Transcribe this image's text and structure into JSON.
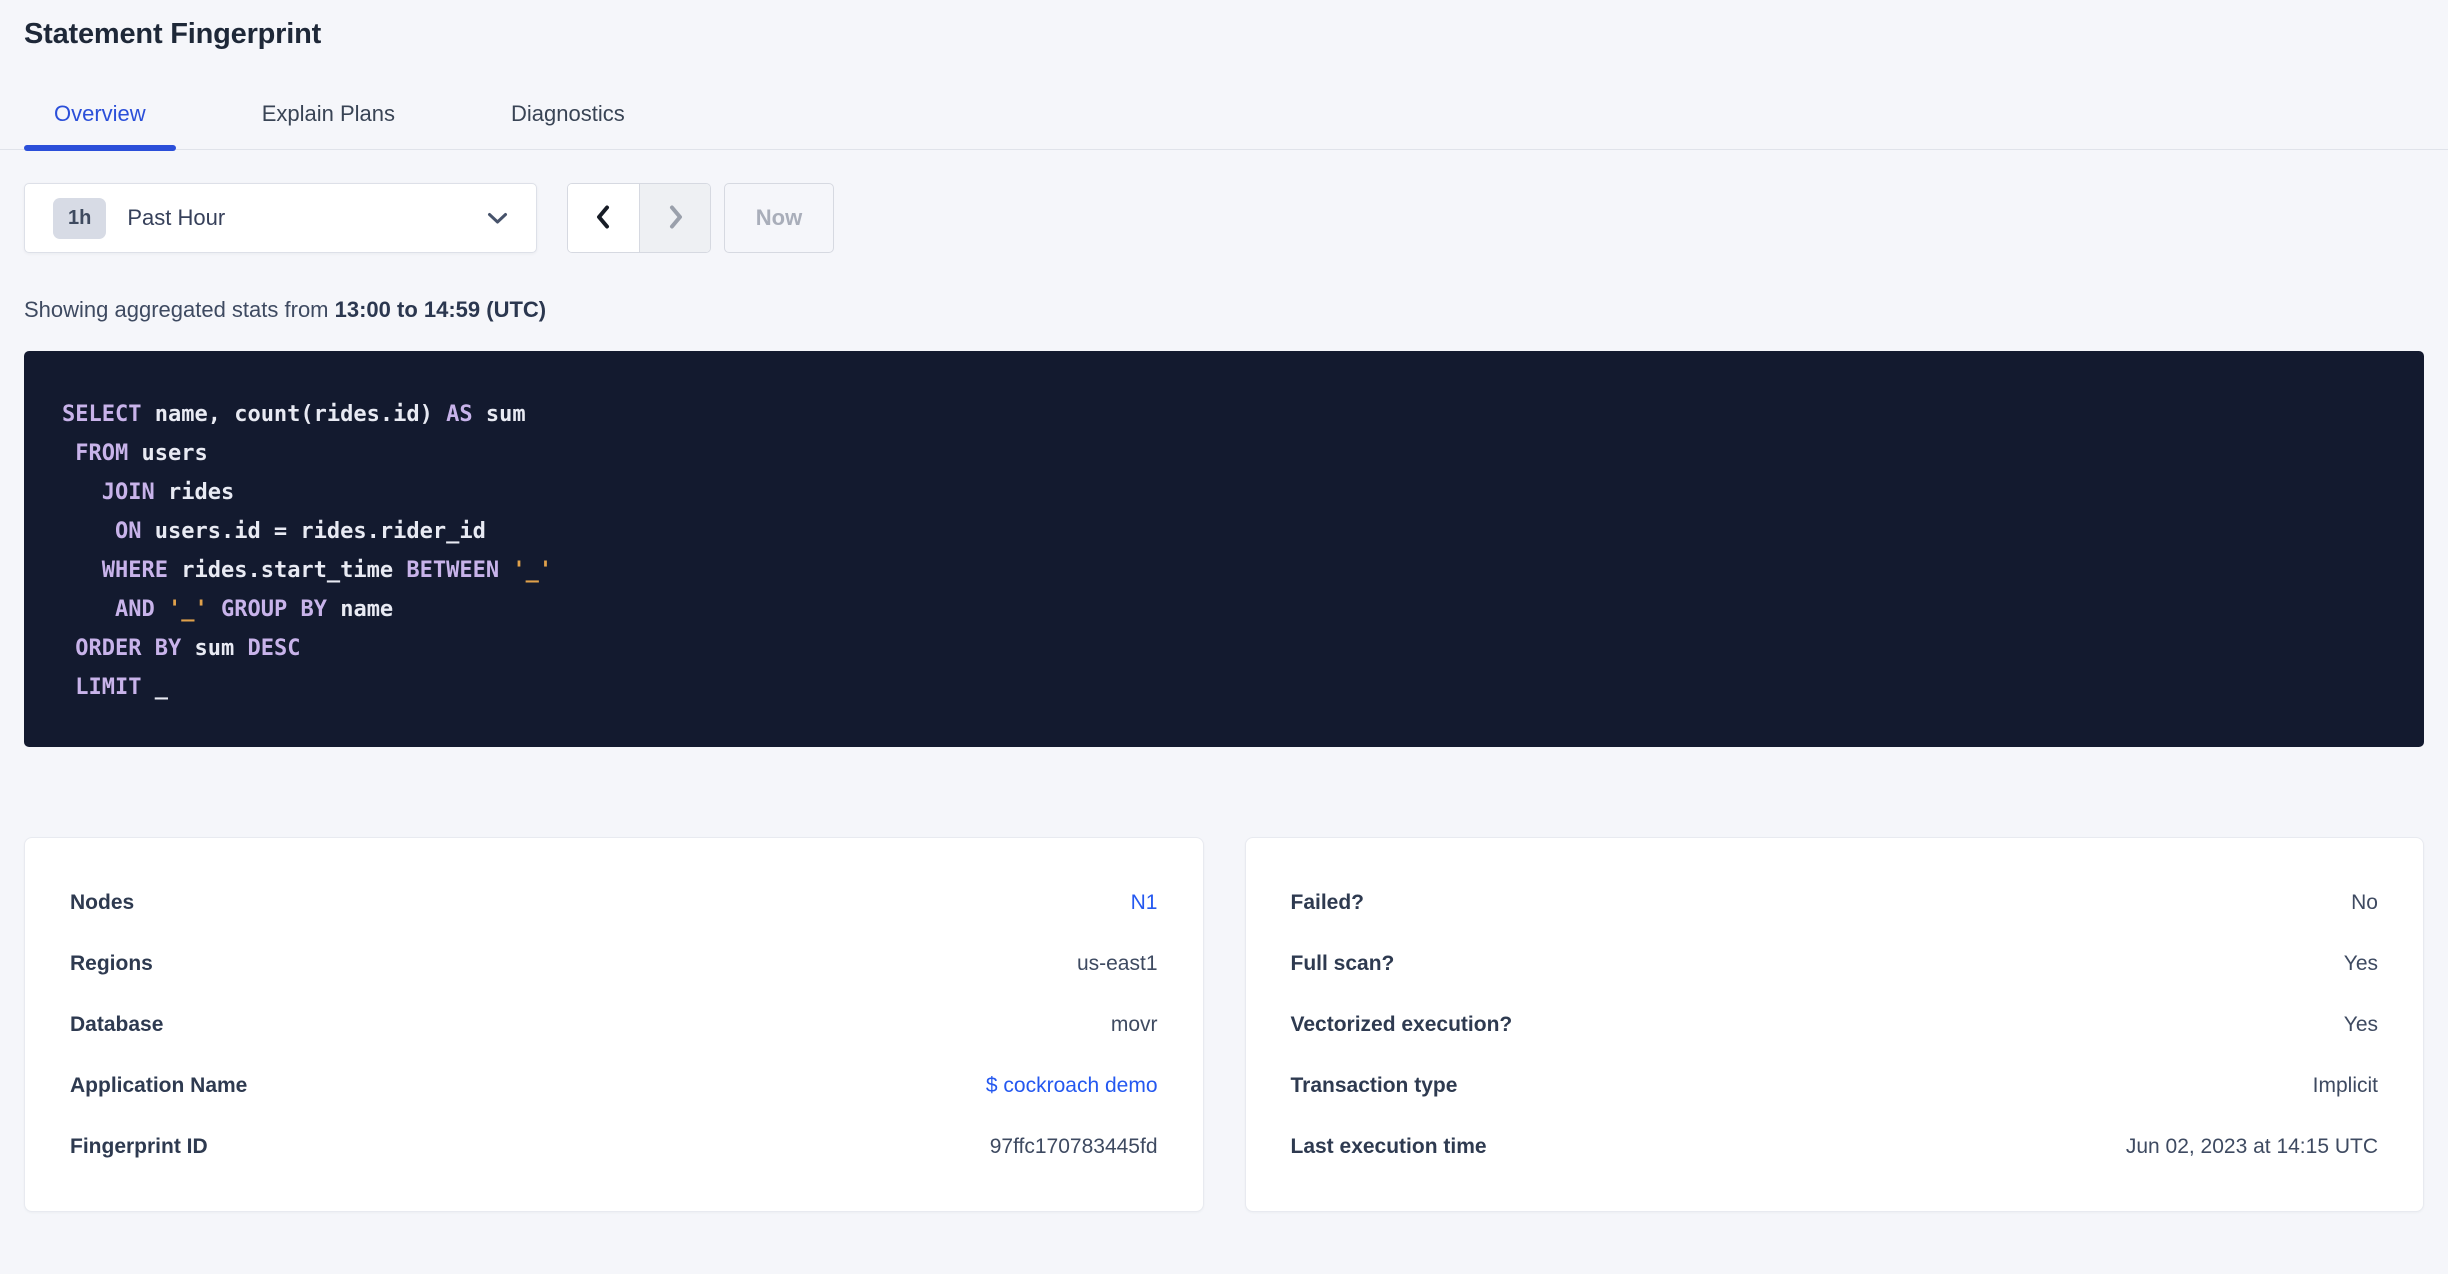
{
  "page": {
    "title": "Statement Fingerprint"
  },
  "tabs": [
    {
      "id": "overview",
      "label": "Overview",
      "active": true
    },
    {
      "id": "explain-plans",
      "label": "Explain Plans",
      "active": false
    },
    {
      "id": "diagnostics",
      "label": "Diagnostics",
      "active": false
    }
  ],
  "time_picker": {
    "interval_badge": "1h",
    "selected_label": "Past Hour",
    "now_label": "Now"
  },
  "stats_line": {
    "prefix": "Showing aggregated stats from ",
    "range_bold": "13:00 to 14:59 (UTC)"
  },
  "sql": {
    "lines": [
      [
        {
          "t": "kw",
          "v": "SELECT"
        },
        {
          "t": "pl",
          "v": " name, count(rides.id) "
        },
        {
          "t": "kw",
          "v": "AS"
        },
        {
          "t": "pl",
          "v": " sum"
        }
      ],
      [
        {
          "t": "pl",
          "v": " "
        },
        {
          "t": "kw",
          "v": "FROM"
        },
        {
          "t": "pl",
          "v": " users"
        }
      ],
      [
        {
          "t": "pl",
          "v": "   "
        },
        {
          "t": "kw",
          "v": "JOIN"
        },
        {
          "t": "pl",
          "v": " rides"
        }
      ],
      [
        {
          "t": "pl",
          "v": "    "
        },
        {
          "t": "kw",
          "v": "ON"
        },
        {
          "t": "pl",
          "v": " users.id = rides.rider_id"
        }
      ],
      [
        {
          "t": "pl",
          "v": "   "
        },
        {
          "t": "kw",
          "v": "WHERE"
        },
        {
          "t": "pl",
          "v": " rides.start_time "
        },
        {
          "t": "kw",
          "v": "BETWEEN"
        },
        {
          "t": "pl",
          "v": " "
        },
        {
          "t": "str",
          "v": "'_'"
        }
      ],
      [
        {
          "t": "pl",
          "v": "    "
        },
        {
          "t": "kw",
          "v": "AND"
        },
        {
          "t": "pl",
          "v": " "
        },
        {
          "t": "str",
          "v": "'_'"
        },
        {
          "t": "pl",
          "v": " "
        },
        {
          "t": "kw",
          "v": "GROUP BY"
        },
        {
          "t": "pl",
          "v": " name"
        }
      ],
      [
        {
          "t": "pl",
          "v": " "
        },
        {
          "t": "kw",
          "v": "ORDER BY"
        },
        {
          "t": "pl",
          "v": " sum "
        },
        {
          "t": "kw",
          "v": "DESC"
        }
      ],
      [
        {
          "t": "pl",
          "v": " "
        },
        {
          "t": "kw",
          "v": "LIMIT"
        },
        {
          "t": "pl",
          "v": " _"
        }
      ]
    ]
  },
  "cards": {
    "left": {
      "rows": [
        {
          "label": "Nodes",
          "value": "N1",
          "link": true
        },
        {
          "label": "Regions",
          "value": "us-east1",
          "link": false
        },
        {
          "label": "Database",
          "value": "movr",
          "link": false
        },
        {
          "label": "Application Name",
          "value": "$ cockroach demo",
          "link": true
        },
        {
          "label": "Fingerprint ID",
          "value": "97ffc170783445fd",
          "link": false
        }
      ]
    },
    "right": {
      "rows": [
        {
          "label": "Failed?",
          "value": "No",
          "link": false
        },
        {
          "label": "Full scan?",
          "value": "Yes",
          "link": false
        },
        {
          "label": "Vectorized execution?",
          "value": "Yes",
          "link": false
        },
        {
          "label": "Transaction type",
          "value": "Implicit",
          "link": false
        },
        {
          "label": "Last execution time",
          "value": "Jun 02, 2023 at 14:15 UTC",
          "link": false
        }
      ]
    }
  },
  "colors": {
    "accent_blue": "#2b4fd9",
    "link_blue": "#2458f0",
    "sql_background": "#131a2f",
    "sql_keyword": "#c8b3ea",
    "sql_plain": "#e8eaf3",
    "sql_string": "#e0a14b"
  }
}
